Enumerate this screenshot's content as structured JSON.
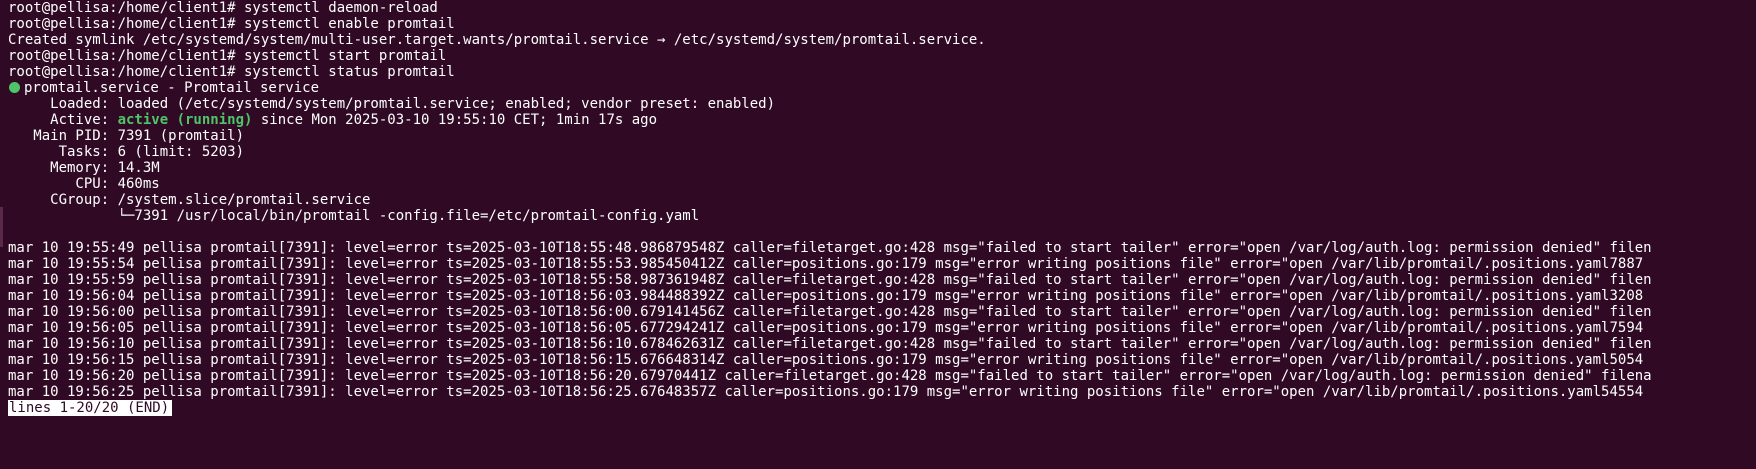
{
  "terminal": {
    "background": "#300a24",
    "green_color": "#4ec468",
    "cmd_lines": [
      "root@pellisa:/home/client1# systemctl daemon-reload",
      "root@pellisa:/home/client1# systemctl enable promtail",
      "Created symlink /etc/systemd/system/multi-user.target.wants/promtail.service → /etc/systemd/system/promtail.service.",
      "root@pellisa:/home/client1# systemctl start promtail",
      "root@pellisa:/home/client1# systemctl status promtail"
    ],
    "status": {
      "status_icon": "green-dot",
      "header": "promtail.service - Promtail service",
      "loaded": "     Loaded: loaded (/etc/systemd/system/promtail.service; enabled; vendor preset: enabled)",
      "active_label": "     Active: ",
      "active_state": "active (running)",
      "active_rest": " since Mon 2025-03-10 19:55:10 CET; 1min 17s ago",
      "main_pid": "   Main PID: 7391 (promtail)",
      "tasks": "      Tasks: 6 (limit: 5203)",
      "memory": "     Memory: 14.3M",
      "cpu": "        CPU: 460ms",
      "cgroup": "     CGroup: /system.slice/promtail.service",
      "cgroup_child": "             └─7391 /usr/local/bin/promtail -config.file=/etc/promtail-config.yaml"
    },
    "log_lines": [
      "mar 10 19:55:49 pellisa promtail[7391]: level=error ts=2025-03-10T18:55:48.986879548Z caller=filetarget.go:428 msg=\"failed to start tailer\" error=\"open /var/log/auth.log: permission denied\" filen",
      "mar 10 19:55:54 pellisa promtail[7391]: level=error ts=2025-03-10T18:55:53.985450412Z caller=positions.go:179 msg=\"error writing positions file\" error=\"open /var/lib/promtail/.positions.yaml7887",
      "mar 10 19:55:59 pellisa promtail[7391]: level=error ts=2025-03-10T18:55:58.987361948Z caller=filetarget.go:428 msg=\"failed to start tailer\" error=\"open /var/log/auth.log: permission denied\" filen",
      "mar 10 19:56:04 pellisa promtail[7391]: level=error ts=2025-03-10T18:56:03.984488392Z caller=positions.go:179 msg=\"error writing positions file\" error=\"open /var/lib/promtail/.positions.yaml3208",
      "mar 10 19:56:00 pellisa promtail[7391]: level=error ts=2025-03-10T18:56:00.679141456Z caller=filetarget.go:428 msg=\"failed to start tailer\" error=\"open /var/log/auth.log: permission denied\" filen",
      "mar 10 19:56:05 pellisa promtail[7391]: level=error ts=2025-03-10T18:56:05.677294241Z caller=positions.go:179 msg=\"error writing positions file\" error=\"open /var/lib/promtail/.positions.yaml7594",
      "mar 10 19:56:10 pellisa promtail[7391]: level=error ts=2025-03-10T18:56:10.678462631Z caller=filetarget.go:428 msg=\"failed to start tailer\" error=\"open /var/log/auth.log: permission denied\" filen",
      "mar 10 19:56:15 pellisa promtail[7391]: level=error ts=2025-03-10T18:56:15.676648314Z caller=positions.go:179 msg=\"error writing positions file\" error=\"open /var/lib/promtail/.positions.yaml5054",
      "mar 10 19:56:20 pellisa promtail[7391]: level=error ts=2025-03-10T18:56:20.67970441Z caller=filetarget.go:428 msg=\"failed to start tailer\" error=\"open /var/log/auth.log: permission denied\" filena",
      "mar 10 19:56:25 pellisa promtail[7391]: level=error ts=2025-03-10T18:56:25.67648357Z caller=positions.go:179 msg=\"error writing positions file\" error=\"open /var/lib/promtail/.positions.yaml54554"
    ],
    "pager_status": "lines 1-20/20 (END)"
  }
}
